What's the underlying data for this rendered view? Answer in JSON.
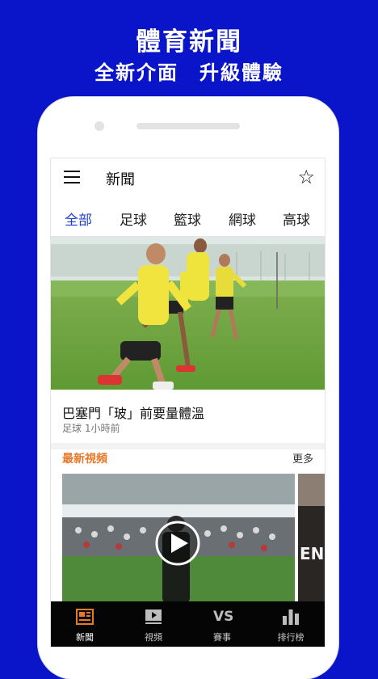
{
  "promo": {
    "title": "體育新聞",
    "subtitle": "全新介面　升級體驗"
  },
  "appbar": {
    "title": "新聞",
    "menu_icon": "menu-icon",
    "star_icon": "star-outline-icon"
  },
  "tabs": [
    {
      "label": "全部",
      "active": true
    },
    {
      "label": "足球",
      "active": false
    },
    {
      "label": "籃球",
      "active": false
    },
    {
      "label": "網球",
      "active": false
    },
    {
      "label": "高球",
      "active": false
    }
  ],
  "article": {
    "headline": "巴塞門「玻」前要量體溫",
    "meta": "足球 1小時前"
  },
  "videos": {
    "section_title": "最新視頻",
    "more_label": "更多",
    "side_text": "EN"
  },
  "bottom_nav": [
    {
      "label": "新聞",
      "icon": "newspaper-icon",
      "active": true
    },
    {
      "label": "視頻",
      "icon": "video-icon",
      "active": false
    },
    {
      "label": "賽事",
      "icon": "vs-icon",
      "icon_text": "VS",
      "active": false
    },
    {
      "label": "排行榜",
      "icon": "leaderboard-icon",
      "active": false
    }
  ],
  "colors": {
    "background": "#0a14c8",
    "accent_tab": "#1f3fc8",
    "section_title": "#e7792b",
    "nav_active": "#e7792b",
    "nav_bg": "#050505"
  }
}
